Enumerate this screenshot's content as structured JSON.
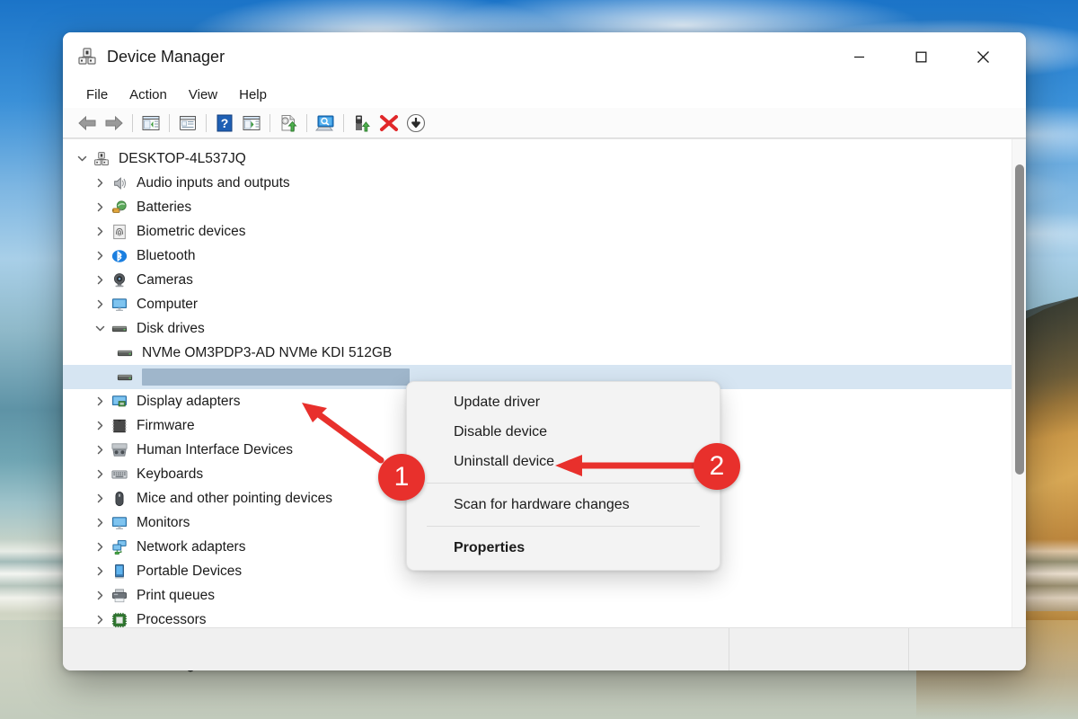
{
  "window": {
    "title": "Device Manager",
    "app_icon": "device-manager-icon",
    "caption": {
      "minimize": "minimize-icon",
      "maximize": "maximize-icon",
      "close": "close-icon"
    }
  },
  "menubar": {
    "items": [
      {
        "label": "File"
      },
      {
        "label": "Action"
      },
      {
        "label": "View"
      },
      {
        "label": "Help"
      }
    ]
  },
  "toolbar": {
    "buttons": [
      {
        "name": "back-icon"
      },
      {
        "name": "forward-icon"
      },
      {
        "name": "show-hide-console-tree-icon"
      },
      {
        "name": "properties-icon"
      },
      {
        "name": "help-icon"
      },
      {
        "name": "show-hide-action-pane-icon"
      },
      {
        "name": "update-driver-icon"
      },
      {
        "name": "scan-for-hardware-changes-icon"
      },
      {
        "name": "enable-device-icon"
      },
      {
        "name": "uninstall-device-icon"
      },
      {
        "name": "disable-device-icon"
      }
    ]
  },
  "tree": {
    "root": {
      "label": "DESKTOP-4L537JQ",
      "icon": "computer-root-icon",
      "expanded": true
    },
    "items": [
      {
        "label": "Audio inputs and outputs",
        "icon": "speaker-icon",
        "level": 1,
        "expanded": false
      },
      {
        "label": "Batteries",
        "icon": "battery-icon",
        "level": 1,
        "expanded": false
      },
      {
        "label": "Biometric devices",
        "icon": "fingerprint-icon",
        "level": 1,
        "expanded": false
      },
      {
        "label": "Bluetooth",
        "icon": "bluetooth-icon",
        "level": 1,
        "expanded": false
      },
      {
        "label": "Cameras",
        "icon": "camera-icon",
        "level": 1,
        "expanded": false
      },
      {
        "label": "Computer",
        "icon": "monitor-icon",
        "level": 1,
        "expanded": false
      },
      {
        "label": "Disk drives",
        "icon": "disk-drive-icon",
        "level": 1,
        "expanded": true
      },
      {
        "label": "NVMe OM3PDP3-AD NVMe KDI 512GB",
        "icon": "disk-drive-icon",
        "level": 2,
        "expanded": null
      },
      {
        "label": "",
        "icon": "disk-drive-icon",
        "level": 2,
        "expanded": null,
        "selected": true,
        "redacted": true
      },
      {
        "label": "Display adapters",
        "icon": "display-adapter-icon",
        "level": 1,
        "expanded": false
      },
      {
        "label": "Firmware",
        "icon": "firmware-chip-icon",
        "level": 1,
        "expanded": false
      },
      {
        "label": "Human Interface Devices",
        "icon": "human-interface-device-icon",
        "level": 1,
        "expanded": false
      },
      {
        "label": "Keyboards",
        "icon": "keyboard-icon",
        "level": 1,
        "expanded": false
      },
      {
        "label": "Mice and other pointing devices",
        "icon": "mouse-icon",
        "level": 1,
        "expanded": false
      },
      {
        "label": "Monitors",
        "icon": "monitor-icon",
        "level": 1,
        "expanded": false
      },
      {
        "label": "Network adapters",
        "icon": "network-adapter-icon",
        "level": 1,
        "expanded": false
      },
      {
        "label": "Portable Devices",
        "icon": "portable-device-icon",
        "level": 1,
        "expanded": false
      },
      {
        "label": "Print queues",
        "icon": "printer-icon",
        "level": 1,
        "expanded": false
      },
      {
        "label": "Processors",
        "icon": "processor-icon",
        "level": 1,
        "expanded": false
      }
    ]
  },
  "context_menu": {
    "items": [
      {
        "label": "Update driver",
        "type": "item",
        "bold": false
      },
      {
        "label": "Disable device",
        "type": "item",
        "bold": false
      },
      {
        "label": "Uninstall device",
        "type": "item",
        "bold": false
      },
      {
        "type": "separator"
      },
      {
        "label": "Scan for hardware changes",
        "type": "item",
        "bold": false
      },
      {
        "type": "separator"
      },
      {
        "label": "Properties",
        "type": "item",
        "bold": true
      }
    ]
  },
  "annotations": {
    "color": "#e8302c",
    "badges": [
      {
        "label": "1",
        "points_at": "selected-disk-drive-row"
      },
      {
        "label": "2",
        "points_at": "uninstall-device-menu-item"
      }
    ]
  },
  "statusbar": {
    "segments": [
      "",
      "",
      ""
    ]
  },
  "colors": {
    "selection": "#d6e5f2",
    "redaction": "#9fb6cb",
    "annotation_red": "#e8302c",
    "window_bg": "#ffffff",
    "menu_bg": "#f3f3f3"
  }
}
